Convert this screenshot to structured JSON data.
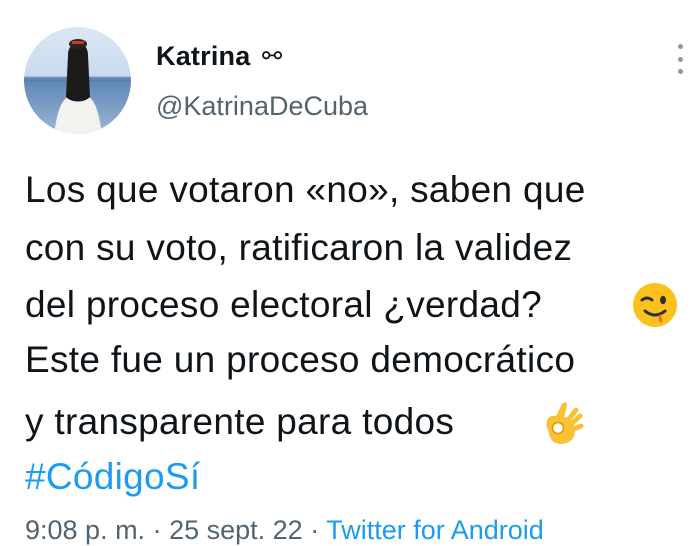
{
  "author": {
    "display_name": "Katrina",
    "name_symbol": "⚯",
    "handle": "@KatrinaDeCuba"
  },
  "tweet": {
    "lines": [
      "Los que votaron «no», saben que",
      "con su voto, ratificaron la validez",
      "del proceso electoral ¿verdad?",
      "Este fue un proceso democrático",
      "y transparente para todos"
    ],
    "emojis": {
      "wink": "winking-face-emoji",
      "ok_hand": "ok-hand-emoji"
    },
    "hashtag": "#CódigoSí"
  },
  "meta": {
    "time": "9:08 p. m.",
    "separator": " · ",
    "date": "25 sept. 22",
    "source": "Twitter for Android"
  },
  "colors": {
    "text": "#0f1419",
    "secondary": "#536471",
    "link": "#1d9bf0"
  }
}
